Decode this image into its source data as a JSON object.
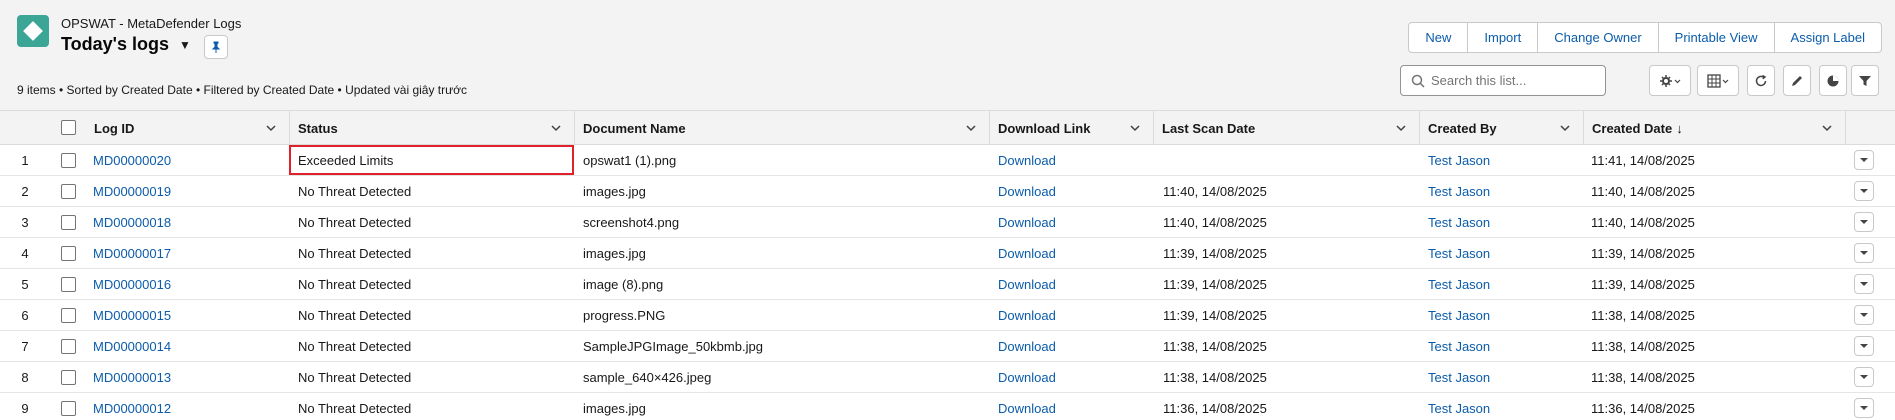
{
  "header": {
    "object_name": "OPSWAT - MetaDefender Logs",
    "list_title": "Today's logs",
    "meta": "9 items • Sorted by Created Date • Filtered by Created Date • Updated vài giây trước"
  },
  "actions": [
    "New",
    "Import",
    "Change Owner",
    "Printable View",
    "Assign Label"
  ],
  "search": {
    "placeholder": "Search this list..."
  },
  "columns": {
    "log_id": "Log ID",
    "status": "Status",
    "document_name": "Document Name",
    "download_link": "Download Link",
    "last_scan_date": "Last Scan Date",
    "created_by": "Created By",
    "created_date": "Created Date",
    "sort_indicator": "↓"
  },
  "rows": [
    {
      "num": "1",
      "log_id": "MD00000020",
      "status": "Exceeded Limits",
      "document": "opswat1 (1).png",
      "download": "Download",
      "last_scan": "",
      "created_by": "Test Jason",
      "created_date": "11:41, 14/08/2025"
    },
    {
      "num": "2",
      "log_id": "MD00000019",
      "status": "No Threat Detected",
      "document": "images.jpg",
      "download": "Download",
      "last_scan": "11:40, 14/08/2025",
      "created_by": "Test Jason",
      "created_date": "11:40, 14/08/2025"
    },
    {
      "num": "3",
      "log_id": "MD00000018",
      "status": "No Threat Detected",
      "document": "screenshot4.png",
      "download": "Download",
      "last_scan": "11:40, 14/08/2025",
      "created_by": "Test Jason",
      "created_date": "11:40, 14/08/2025"
    },
    {
      "num": "4",
      "log_id": "MD00000017",
      "status": "No Threat Detected",
      "document": "images.jpg",
      "download": "Download",
      "last_scan": "11:39, 14/08/2025",
      "created_by": "Test Jason",
      "created_date": "11:39, 14/08/2025"
    },
    {
      "num": "5",
      "log_id": "MD00000016",
      "status": "No Threat Detected",
      "document": "image (8).png",
      "download": "Download",
      "last_scan": "11:39, 14/08/2025",
      "created_by": "Test Jason",
      "created_date": "11:39, 14/08/2025"
    },
    {
      "num": "6",
      "log_id": "MD00000015",
      "status": "No Threat Detected",
      "document": "progress.PNG",
      "download": "Download",
      "last_scan": "11:39, 14/08/2025",
      "created_by": "Test Jason",
      "created_date": "11:38, 14/08/2025"
    },
    {
      "num": "7",
      "log_id": "MD00000014",
      "status": "No Threat Detected",
      "document": "SampleJPGImage_50kbmb.jpg",
      "download": "Download",
      "last_scan": "11:38, 14/08/2025",
      "created_by": "Test Jason",
      "created_date": "11:38, 14/08/2025"
    },
    {
      "num": "8",
      "log_id": "MD00000013",
      "status": "No Threat Detected",
      "document": "sample_640×426.jpeg",
      "download": "Download",
      "last_scan": "11:38, 14/08/2025",
      "created_by": "Test Jason",
      "created_date": "11:38, 14/08/2025"
    },
    {
      "num": "9",
      "log_id": "MD00000012",
      "status": "No Threat Detected",
      "document": "images.jpg",
      "download": "Download",
      "last_scan": "11:36, 14/08/2025",
      "created_by": "Test Jason",
      "created_date": "11:36, 14/08/2025"
    }
  ],
  "icons": {
    "app": "metadefender-app-icon",
    "pin": "pin-icon",
    "search": "search-icon",
    "settings": "gear-icon",
    "table_view": "table-view-icon",
    "refresh": "refresh-icon",
    "edit": "pencil-icon",
    "chart": "pie-chart-icon",
    "filter": "filter-icon",
    "row_action": "chevron-down-icon"
  },
  "colors": {
    "accent": "#0b5cab",
    "app_icon": "#3ba696",
    "highlight": "#e0202b"
  }
}
